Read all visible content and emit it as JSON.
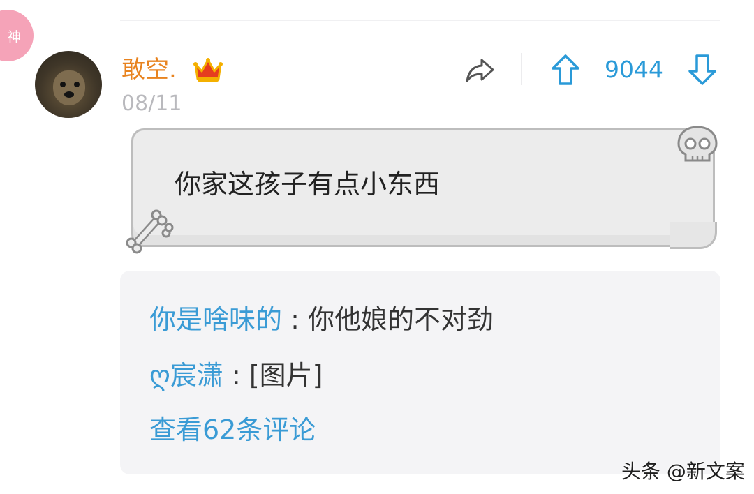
{
  "badge": "神",
  "post": {
    "username": "敢空.",
    "date": "08/11",
    "vote_count": "9044",
    "text": "你家这孩子有点小东西"
  },
  "comments": [
    {
      "name": "你是啥味的",
      "sep": " : ",
      "text": "你他娘的不对劲"
    },
    {
      "name": "ღ宸潇",
      "sep": " : ",
      "text": "[图片]"
    }
  ],
  "view_comments": "查看62条评论",
  "watermark": "头条 @新文案",
  "icons": [
    "crown-icon",
    "share-icon",
    "upvote-icon",
    "downvote-icon",
    "skull-icon",
    "bone-icon"
  ],
  "colors": {
    "username": "#e8831f",
    "accent": "#2a9ad8",
    "badge": "#f5a3b8"
  }
}
